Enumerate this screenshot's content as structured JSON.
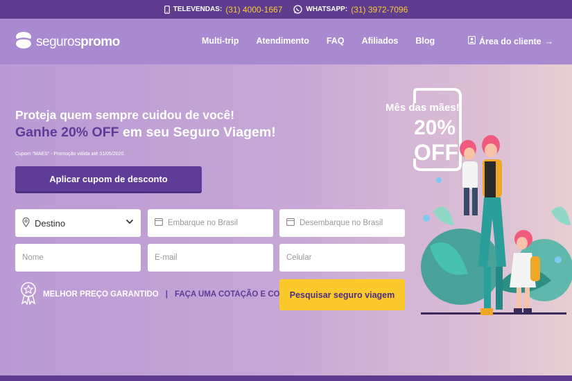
{
  "topbar": {
    "televendas_label": "TELEVENDAS:",
    "televendas_number": "(31) 4000-1667",
    "whatsapp_label": "WHATSAPP:",
    "whatsapp_number": "(31) 3972-7096"
  },
  "brand": {
    "name_light": "seguros",
    "name_bold": "promo"
  },
  "nav": {
    "items": [
      "Multi-trip",
      "Atendimento",
      "FAQ",
      "Afiliados",
      "Blog"
    ],
    "client_area": "Área do cliente"
  },
  "hero": {
    "headline": "Proteja quem sempre cuidou de você!",
    "subheadline_prefix": "Ganhe 20% OFF",
    "subheadline_suffix": " em seu Seguro Viagem!",
    "coupon_note": "Cupom \"MAES\" - Promoção válida até 31/05/2020.",
    "apply_button": "Aplicar cupom de desconto"
  },
  "form": {
    "destination": "Destino",
    "embark_placeholder": "Embarque no Brasil",
    "disembark_placeholder": "Desembarque no Brasil",
    "name_placeholder": "Nome",
    "email_placeholder": "E-mail",
    "phone_placeholder": "Celular",
    "search_button": "Pesquisar seguro viagem"
  },
  "guarantee": {
    "best_price": "MELHOR PREÇO GARANTIDO",
    "separator": "|",
    "quote": "FAÇA UMA COTAÇÃO E CONFIRA."
  },
  "promo": {
    "title": "Mês das mães!",
    "percent": "20%",
    "off": "OFF"
  },
  "colors": {
    "purple_dark": "#5e3d8f",
    "purple_nav": "#a88ad0",
    "yellow": "#fcc92d",
    "accent_text": "#5b3d99"
  }
}
